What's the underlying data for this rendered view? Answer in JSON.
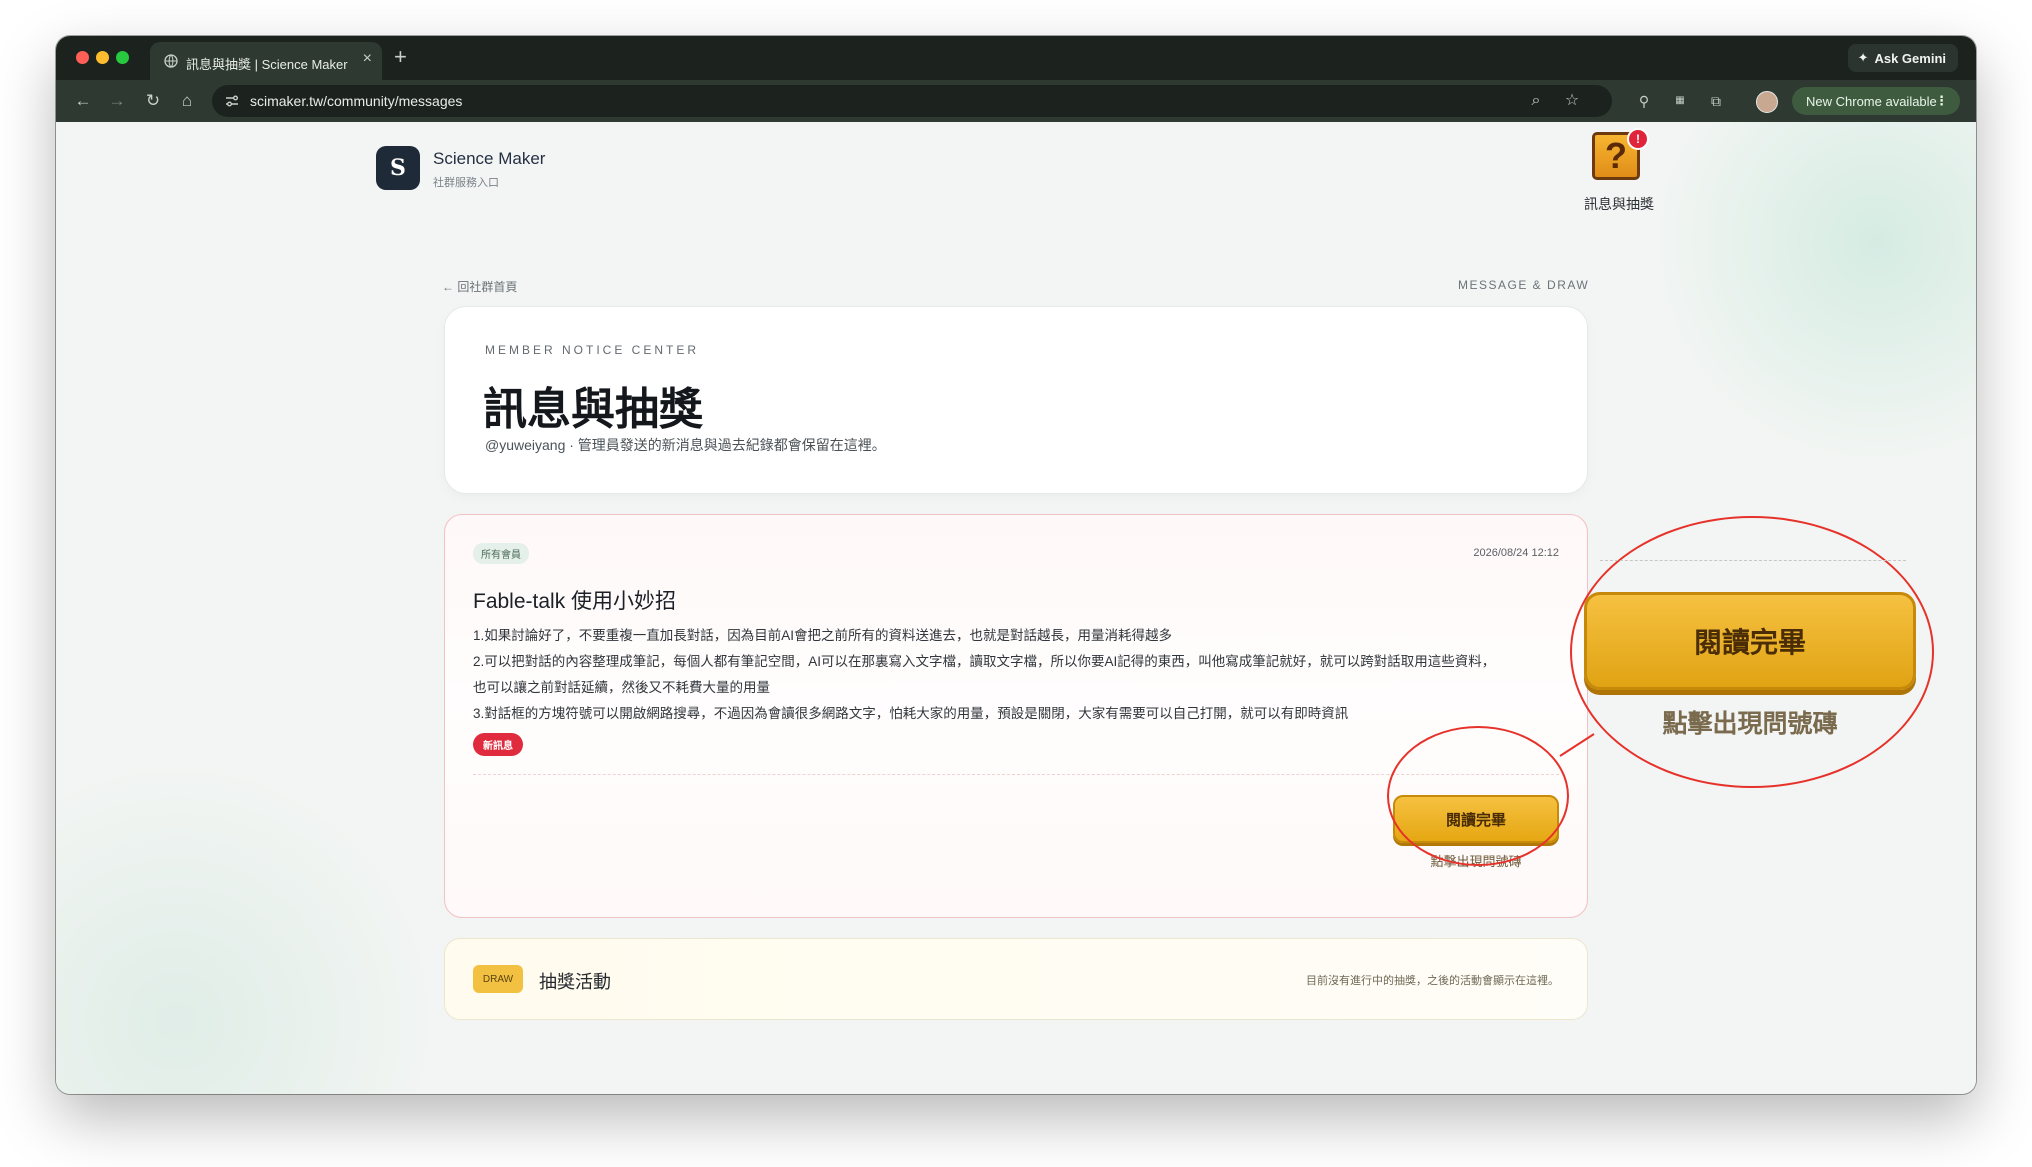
{
  "browser": {
    "tab_title": "訊息與抽獎 | Science Maker",
    "new_tab_symbol": "+",
    "ask_gemini": "Ask Gemini",
    "url": "scimaker.tw/community/messages",
    "new_chrome": "New Chrome available"
  },
  "brand": {
    "logo_letter": "S",
    "name": "Science Maker",
    "subtitle": "社群服務入口"
  },
  "gift": {
    "icon": "question-block-icon",
    "badge": "!",
    "label": "訊息與抽獎"
  },
  "nav": {
    "back": "← 回社群首頁",
    "section": "MESSAGE & DRAW"
  },
  "header": {
    "eyebrow": "MEMBER NOTICE CENTER",
    "title": "訊息與抽獎",
    "subtitle": "@yuweiyang · 管理員發送的新消息與過去紀錄都會保留在這裡。"
  },
  "message": {
    "audience": "所有會員",
    "date": "2026/08/24 12:12",
    "title": "Fable-talk 使用小妙招",
    "body": [
      "1.如果討論好了，不要重複一直加長對話，因為目前AI會把之前所有的資料送進去，也就是對話越長，用量消耗得越多",
      "2.可以把對話的內容整理成筆記，每個人都有筆記空間，AI可以在那裏寫入文字檔，讀取文字檔，所以你要AI記得的東西，叫他寫成筆記就好，就可以跨對話取用這些資料，",
      "也可以讓之前對話延續，然後又不耗費大量的用量",
      "3.對話框的方塊符號可以開啟網路搜尋，不過因為會讀很多網路文字，怕耗大家的用量，預設是關閉，大家有需要可以自己打開，就可以有即時資訊"
    ],
    "new_badge": "新訊息",
    "read_button": "閱讀完畢",
    "read_hint": "點擊出現問號磚"
  },
  "draw": {
    "tag": "DRAW",
    "title": "抽獎活動",
    "note": "目前沒有進行中的抽獎，之後的活動會顯示在這裡。"
  },
  "annotation": {
    "zoom_button": "閱讀完畢",
    "zoom_hint": "點擊出現問號磚",
    "color": "#e6322a"
  }
}
